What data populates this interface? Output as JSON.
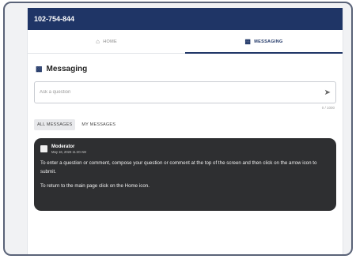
{
  "header": {
    "phone": "102-754-844"
  },
  "tabs": [
    {
      "label": "HOME",
      "icon": "home-icon",
      "active": false
    },
    {
      "label": "MESSAGING",
      "icon": "chat-icon",
      "active": true
    }
  ],
  "section": {
    "title": "Messaging",
    "icon": "chat-icon"
  },
  "ask": {
    "placeholder": "Ask a question",
    "value": "",
    "counter": "0 / 1000",
    "send_icon": "send-icon"
  },
  "filters": [
    {
      "label": "ALL MESSAGES",
      "active": true
    },
    {
      "label": "MY MESSAGES",
      "active": false
    }
  ],
  "message": {
    "author": "Moderator",
    "date": "May 16, 2023 11:20 AM",
    "avatar_icon": "moderator-avatar-icon",
    "paragraphs": [
      "To enter a question or comment, compose your question or comment at the top of the screen and then click on the arrow icon to submit.",
      "To return to the main page click on the Home icon."
    ]
  },
  "colors": {
    "header_bg": "#1f3566",
    "card_bg": "#2e2f31",
    "accent": "#1f3566"
  }
}
